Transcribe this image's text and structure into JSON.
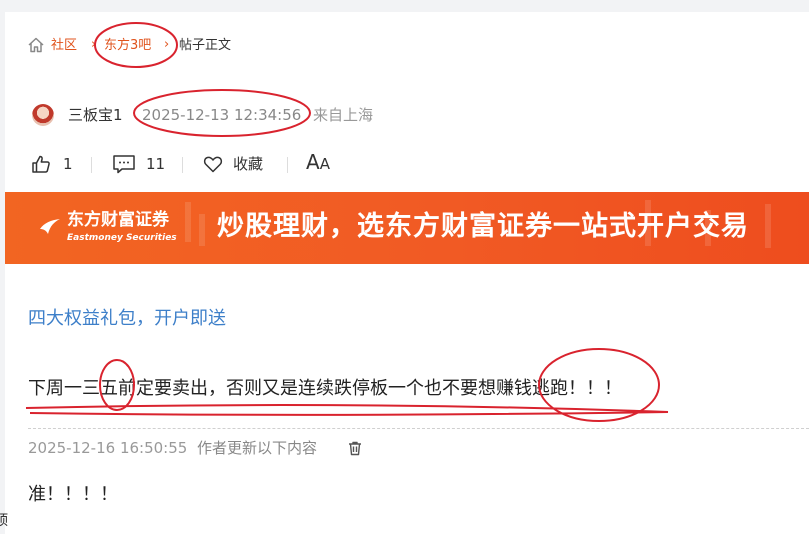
{
  "breadcrumb": {
    "home_label": "社区",
    "bar_label": "东方3吧",
    "current_label": "帖子正文"
  },
  "post": {
    "author": "三板宝1",
    "time": "2025-12-13 12:34:56",
    "location": "来自上海"
  },
  "actions": {
    "like_count": "1",
    "comment_count": "11",
    "favorite_label": "收藏",
    "font_size_label_big": "A",
    "font_size_label_small": "A"
  },
  "banner": {
    "logo_cn": "东方财富证券",
    "logo_en": "Eastmoney Securities",
    "slogan": "炒股理财，选东方财富证券一站式开户交易"
  },
  "content": {
    "promo_link": "四大权益礼包，开户即送",
    "body": "下周一三五前定要卖出，否则又是连续跌停板一个也不要想赚钱逃跑！！！"
  },
  "update": {
    "time": "2025-12-16 16:50:55",
    "label": "作者更新以下内容",
    "body": "准！！！！"
  },
  "edge_text": "顶",
  "colors": {
    "accent": "#e0531c",
    "link_blue": "#3d7fc9",
    "annotation_red": "#d9232e",
    "banner_orange": "#f15a24"
  },
  "icons": [
    "home-icon",
    "chevron-right-icon",
    "thumb-up-icon",
    "comment-icon",
    "heart-icon",
    "trash-icon",
    "eastmoney-logo-icon"
  ]
}
